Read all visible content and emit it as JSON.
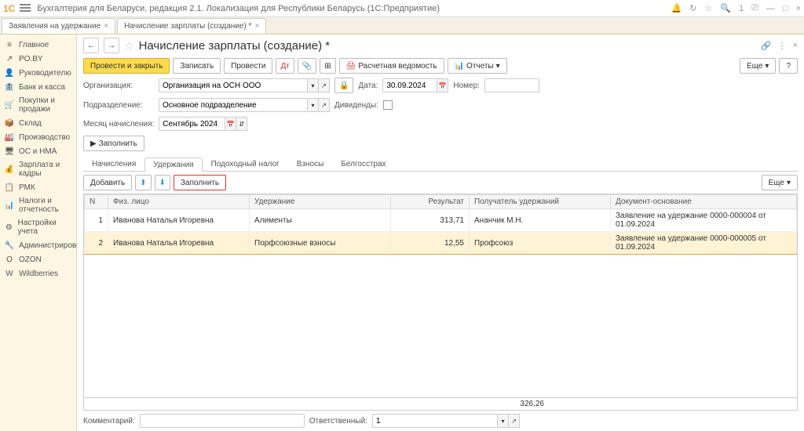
{
  "titlebar": {
    "logo": "1С",
    "app_title": "Бухгалтерия для Беларуси, редакция 2.1. Локализация для Республики Беларусь  (1С:Предприятие)",
    "search_badge": "1"
  },
  "tabs": [
    {
      "label": "Заявления на удержание",
      "close": "×"
    },
    {
      "label": "Начисление зарплаты (создание) *",
      "close": "×"
    }
  ],
  "sidebar": [
    {
      "icon": "≡",
      "label": "Главное"
    },
    {
      "icon": "↗",
      "label": "PO.BY"
    },
    {
      "icon": "👤",
      "label": "Руководителю"
    },
    {
      "icon": "🏦",
      "label": "Банк и касса"
    },
    {
      "icon": "🛒",
      "label": "Покупки и продажи"
    },
    {
      "icon": "📦",
      "label": "Склад"
    },
    {
      "icon": "🏭",
      "label": "Производство"
    },
    {
      "icon": "🖥",
      "label": "ОС и НМА"
    },
    {
      "icon": "💰",
      "label": "Зарплата и кадры"
    },
    {
      "icon": "📋",
      "label": "РМК"
    },
    {
      "icon": "📊",
      "label": "Налоги и отчетность"
    },
    {
      "icon": "⚙",
      "label": "Настройки учета"
    },
    {
      "icon": "🔧",
      "label": "Администрирование"
    },
    {
      "icon": "O",
      "label": "OZON"
    },
    {
      "icon": "W",
      "label": "Wildberries"
    }
  ],
  "doc": {
    "title": "Начисление зарплаты (создание) *",
    "nav_back": "←",
    "nav_fwd": "→"
  },
  "toolbar": {
    "post_close": "Провести и закрыть",
    "save": "Записать",
    "post": "Провести",
    "payroll_sheet": "Расчетная ведомость",
    "reports": "Отчеты",
    "more": "Еще",
    "help": "?"
  },
  "form": {
    "org_label": "Организация:",
    "org_value": "Организация на ОСН ООО",
    "date_label": "Дата:",
    "date_value": "30.09.2024",
    "number_label": "Номер:",
    "subdiv_label": "Подразделение:",
    "subdiv_value": "Основное подразделение",
    "dividends_label": "Дивиденды:",
    "month_label": "Месяц начисления:",
    "month_value": "Сентябрь 2024"
  },
  "fill_btn": "Заполнить",
  "tabs2": [
    "Начисления",
    "Удержания",
    "Подоходный налог",
    "Взносы",
    "Белгосстрах"
  ],
  "active_tab2": 1,
  "subtoolbar": {
    "add": "Добавить",
    "up": "↑",
    "down": "↓",
    "fill": "Заполнить",
    "more": "Еще"
  },
  "table": {
    "headers": [
      "N",
      "Физ. лицо",
      "Удержание",
      "Результат",
      "Получатель удержаний",
      "Документ-основание"
    ],
    "rows": [
      {
        "n": "1",
        "person": "Иванова Наталья Игоревна",
        "ded": "Алименты",
        "result": "313,71",
        "recipient": "Ананчик М.Н.",
        "doc": "Заявление на удержание 0000-000004 от 01.09.2024"
      },
      {
        "n": "2",
        "person": "Иванова Наталья Игоревна",
        "ded": "Порфсоюзные взносы",
        "result": "12,55",
        "recipient": "Профсоюз",
        "doc": "Заявление на удержание 0000-000005 от 01.09.2024"
      }
    ],
    "total": "326,26"
  },
  "bottom": {
    "comment_label": "Комментарий:",
    "responsible_label": "Ответственный:",
    "responsible_value": "1"
  }
}
